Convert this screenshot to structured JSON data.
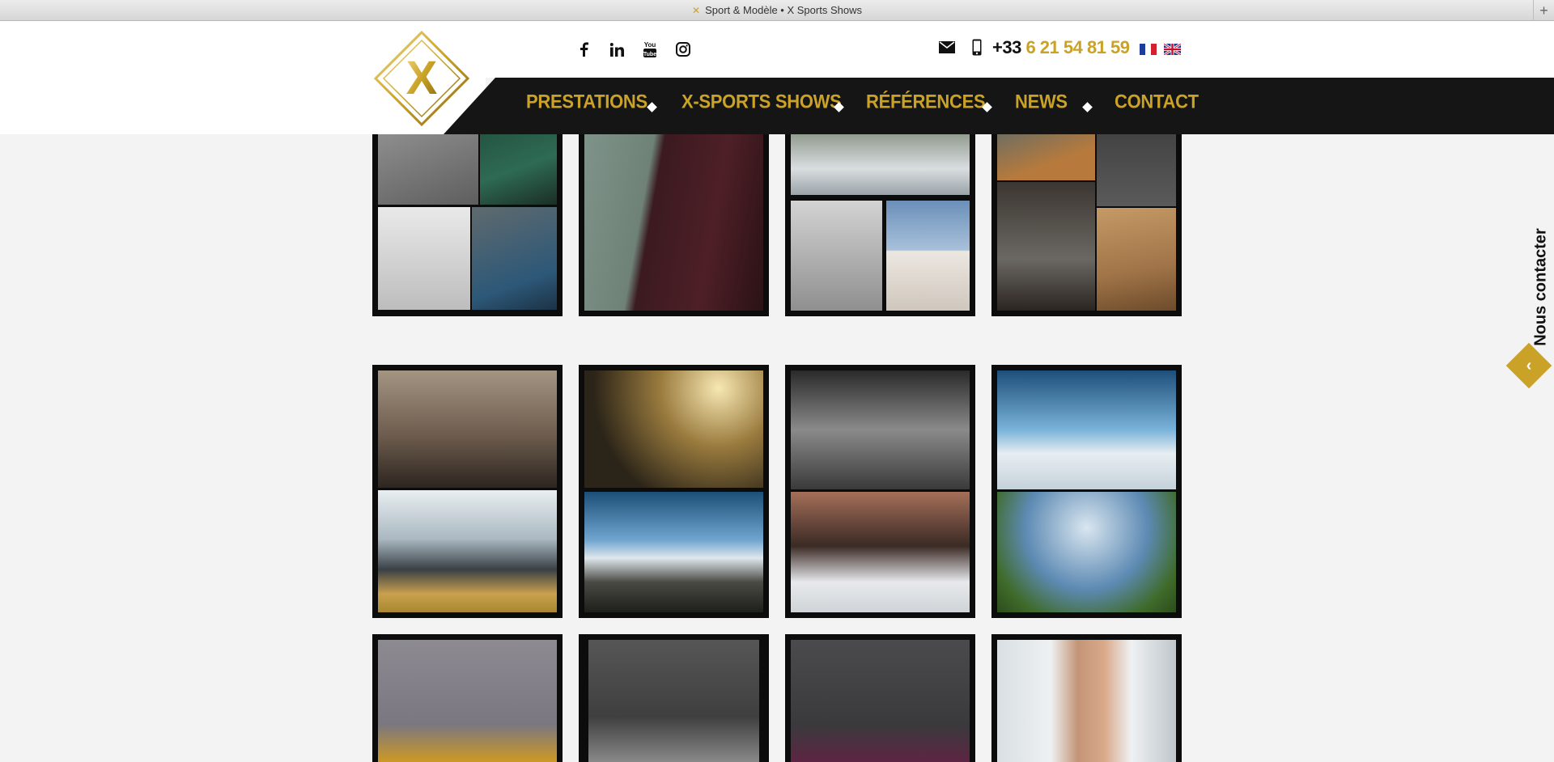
{
  "window": {
    "title": "Sport & Modèle • X Sports Shows"
  },
  "header": {
    "logo_letter": "X",
    "social": [
      "facebook-icon",
      "linkedin-icon",
      "youtube-icon",
      "instagram-icon"
    ],
    "phone_prefix": "+33",
    "phone_number": "6 21 54 81 59",
    "languages": [
      "fr",
      "en"
    ]
  },
  "nav": {
    "items": [
      "PRESTATIONS",
      "X-SPORTS SHOWS",
      "RÉFÉRENCES",
      "NEWS",
      "CONTACT"
    ]
  },
  "side": {
    "contact_label": "Nous contacter"
  },
  "colors": {
    "gold": "#c9a227",
    "dark": "#151515",
    "background": "#f3f3f3"
  }
}
